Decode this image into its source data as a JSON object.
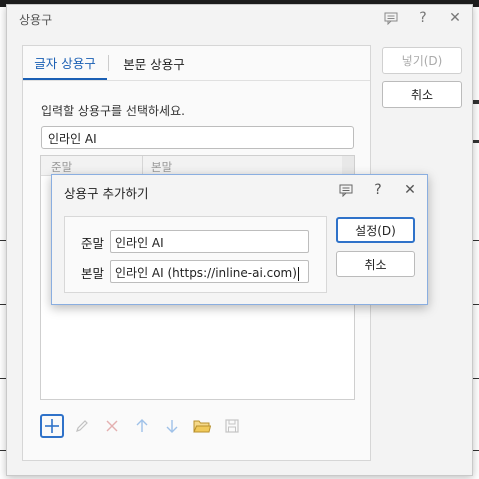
{
  "main_dialog": {
    "title": "상용구",
    "tabs": [
      {
        "label": "글자 상용구",
        "active": true
      },
      {
        "label": "본문 상용구",
        "active": false
      }
    ],
    "instruction": "입력할 상용구를 선택하세요.",
    "search_value": "인라인 AI",
    "list_columns": [
      "준말",
      "본말"
    ],
    "insert_button": "넣기(D)",
    "cancel_button": "취소",
    "toolbar_icons": [
      "add-icon",
      "edit-icon",
      "delete-icon",
      "move-up-icon",
      "move-down-icon",
      "open-folder-icon",
      "save-icon"
    ]
  },
  "sub_dialog": {
    "title": "상용구 추가하기",
    "short_label": "준말",
    "short_value": "인라인 AI",
    "long_label": "본말",
    "long_value": "인라인 AI (https://inline-ai.com)",
    "set_button": "설정(D)",
    "cancel_button": "취소"
  },
  "colors": {
    "accent": "#2f72c9",
    "tab_active": "#1a5fb4",
    "dialog_bg": "#f3f3f3",
    "sub_border": "#8aaee0"
  }
}
